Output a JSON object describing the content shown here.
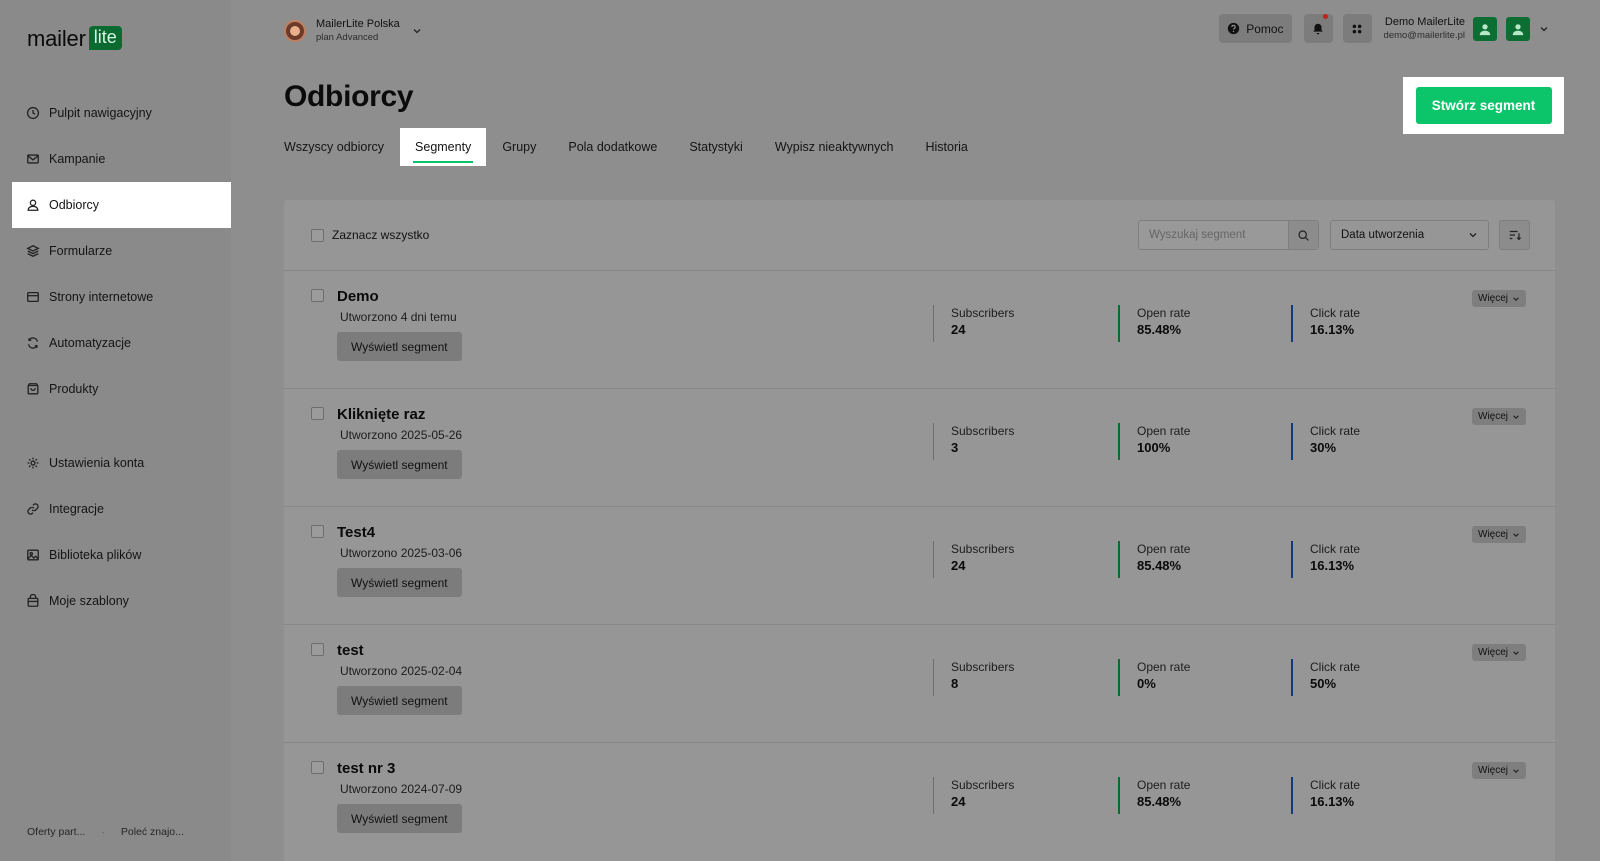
{
  "logo": {
    "text": "mailer",
    "badge": "lite"
  },
  "sidebar": {
    "items": [
      {
        "label": "Pulpit nawigacyjny",
        "icon": "clock-icon",
        "active": false
      },
      {
        "label": "Kampanie",
        "icon": "mail-icon",
        "active": false
      },
      {
        "label": "Odbiorcy",
        "icon": "user-icon",
        "active": true
      },
      {
        "label": "Formularze",
        "icon": "layers-icon",
        "active": false
      },
      {
        "label": "Strony internetowe",
        "icon": "browser-icon",
        "active": false
      },
      {
        "label": "Automatyzacje",
        "icon": "refresh-icon",
        "active": false
      },
      {
        "label": "Produkty",
        "icon": "bag-icon",
        "active": false
      }
    ],
    "settings_items": [
      {
        "label": "Ustawienia konta",
        "icon": "gear-icon"
      },
      {
        "label": "Integracje",
        "icon": "link-icon"
      },
      {
        "label": "Biblioteka plików",
        "icon": "image-icon"
      },
      {
        "label": "Moje szablony",
        "icon": "template-icon"
      }
    ],
    "footer": {
      "left": "Oferty part...",
      "separator": "·",
      "right": "Poleć znajo..."
    }
  },
  "account": {
    "name": "MailerLite Polska",
    "plan": "plan Advanced"
  },
  "topbar": {
    "help_label": "Pomoc",
    "user_name": "Demo MailerLite",
    "user_email": "demo@mailerlite.pl"
  },
  "page": {
    "title": "Odbiorcy",
    "create_button": "Stwórz segment",
    "tabs": [
      {
        "label": "Wszyscy odbiorcy",
        "active": false
      },
      {
        "label": "Segmenty",
        "active": true
      },
      {
        "label": "Grupy",
        "active": false
      },
      {
        "label": "Pola dodatkowe",
        "active": false
      },
      {
        "label": "Statystyki",
        "active": false
      },
      {
        "label": "Wypisz nieaktywnych",
        "active": false
      },
      {
        "label": "Historia",
        "active": false
      }
    ]
  },
  "toolbar": {
    "select_all": "Zaznacz wszystko",
    "search_placeholder": "Wyszukaj segment",
    "sort_value": "Data utworzenia"
  },
  "labels": {
    "view_segment": "Wyświetl segment",
    "subscribers": "Subscribers",
    "open_rate": "Open rate",
    "click_rate": "Click rate",
    "more": "Więcej"
  },
  "segments": [
    {
      "name": "Demo",
      "created": "Utworzono 4 dni temu",
      "subscribers": "24",
      "open_rate": "85.48%",
      "click_rate": "16.13%"
    },
    {
      "name": "Kliknięte raz",
      "created": "Utworzono 2025-05-26",
      "subscribers": "3",
      "open_rate": "100%",
      "click_rate": "30%"
    },
    {
      "name": "Test4",
      "created": "Utworzono 2025-03-06",
      "subscribers": "24",
      "open_rate": "85.48%",
      "click_rate": "16.13%"
    },
    {
      "name": "test",
      "created": "Utworzono 2025-02-04",
      "subscribers": "8",
      "open_rate": "0%",
      "click_rate": "50%"
    },
    {
      "name": "test nr 3",
      "created": "Utworzono 2024-07-09",
      "subscribers": "24",
      "open_rate": "85.48%",
      "click_rate": "16.13%"
    }
  ],
  "colors": {
    "brand_green": "#09c269",
    "open_rate_accent": "#0a6a30",
    "click_rate_accent": "#123a7a",
    "notification_dot": "#c0241b"
  }
}
